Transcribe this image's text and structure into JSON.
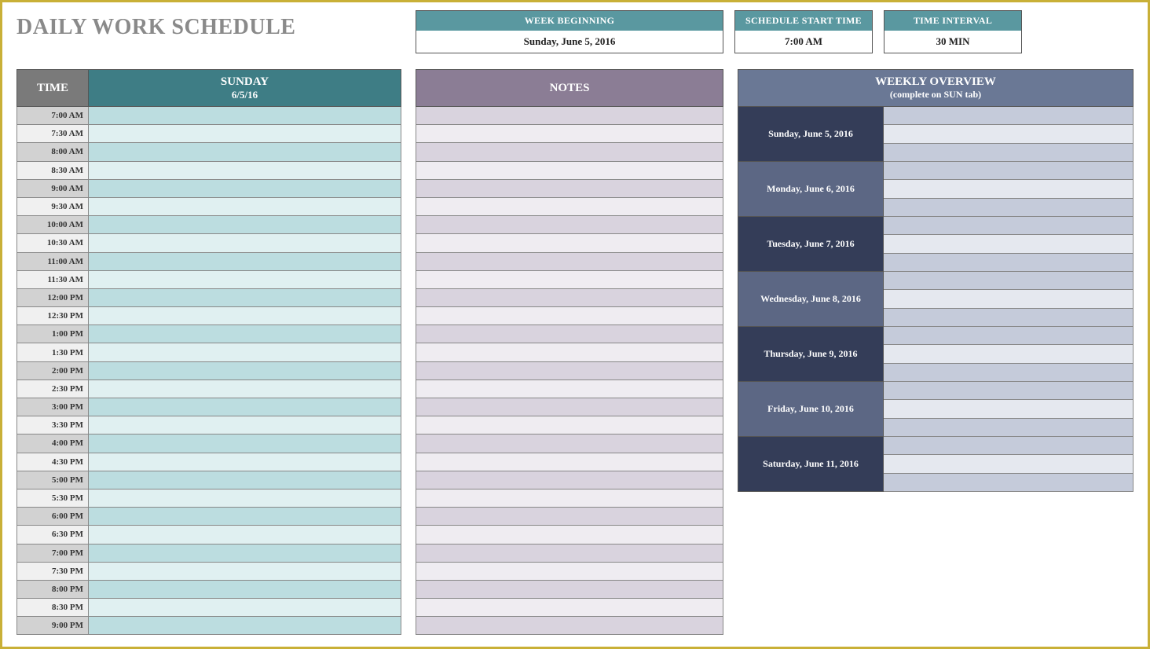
{
  "title": "DAILY WORK SCHEDULE",
  "info": {
    "week_beginning": {
      "label": "WEEK BEGINNING",
      "value": "Sunday, June 5, 2016"
    },
    "start_time": {
      "label": "SCHEDULE START TIME",
      "value": "7:00 AM"
    },
    "interval": {
      "label": "TIME INTERVAL",
      "value": "30 MIN"
    }
  },
  "schedule": {
    "time_header": "TIME",
    "day_name": "SUNDAY",
    "day_date": "6/5/16",
    "times": [
      "7:00 AM",
      "7:30 AM",
      "8:00 AM",
      "8:30 AM",
      "9:00 AM",
      "9:30 AM",
      "10:00 AM",
      "10:30 AM",
      "11:00 AM",
      "11:30 AM",
      "12:00 PM",
      "12:30 PM",
      "1:00 PM",
      "1:30 PM",
      "2:00 PM",
      "2:30 PM",
      "3:00 PM",
      "3:30 PM",
      "4:00 PM",
      "4:30 PM",
      "5:00 PM",
      "5:30 PM",
      "6:00 PM",
      "6:30 PM",
      "7:00 PM",
      "7:30 PM",
      "8:00 PM",
      "8:30 PM",
      "9:00 PM"
    ]
  },
  "notes": {
    "header": "NOTES",
    "rows": 29
  },
  "weekly": {
    "header": "WEEKLY OVERVIEW",
    "subheader": "(complete on SUN tab)",
    "days": [
      "Sunday, June 5, 2016",
      "Monday, June 6, 2016",
      "Tuesday, June 7, 2016",
      "Wednesday, June 8, 2016",
      "Thursday, June 9, 2016",
      "Friday, June 10, 2016",
      "Saturday, June 11, 2016"
    ]
  }
}
